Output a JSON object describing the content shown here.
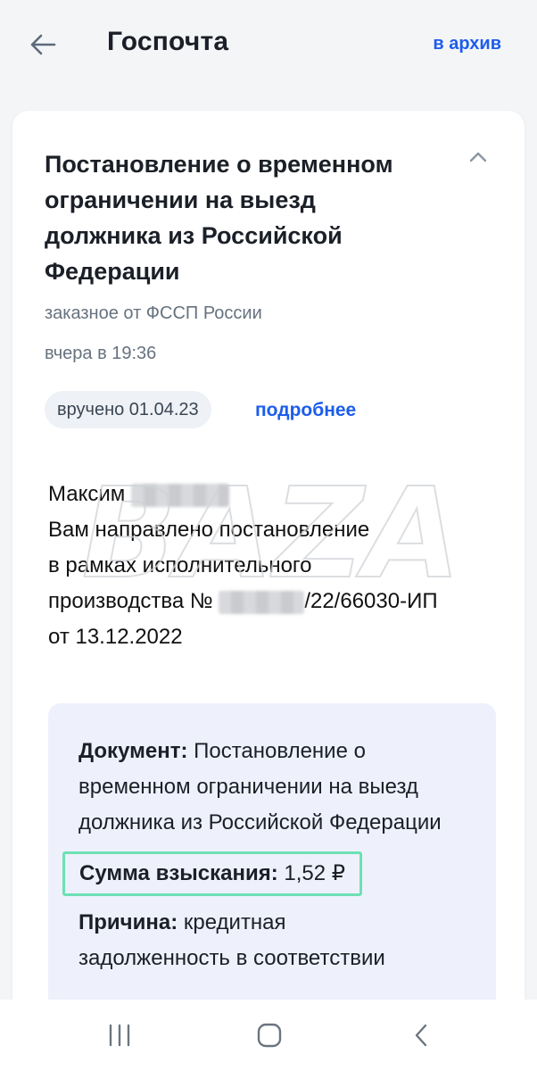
{
  "header": {
    "title": "Госпочта",
    "archive_label": "в архив"
  },
  "letter": {
    "subject": "Постановление о временном\nограничении на выезд\nдолжника из Российской\nФедерации",
    "sender": "заказное от ФССП России",
    "time": "вчера в 19:36",
    "status_badge": "вручено 01.04.23",
    "details_label": "подробнее",
    "body": {
      "name": "Максим",
      "line1": "Вам направлено постановление",
      "line2": "в рамках исполнительного",
      "line3_prefix": "производства №",
      "line3_suffix": "/22/66030-ИП",
      "line4": "от 13.12.2022"
    },
    "info": {
      "document_label": "Документ:",
      "document_value": "Постановление о временном ограничении на выезд должника из Российской Федерации",
      "amount_label": "Сумма взыскания:",
      "amount_value": "1,52 ₽",
      "reason_label": "Причина:",
      "reason_value": "кредитная",
      "reason_cont": "задолженность в соответствии"
    }
  },
  "watermark": "BAZA",
  "colors": {
    "accent": "#1d5deb",
    "highlight_border": "#6ee0b4",
    "info_bg": "#eef1fb",
    "muted_text": "#66727f"
  }
}
